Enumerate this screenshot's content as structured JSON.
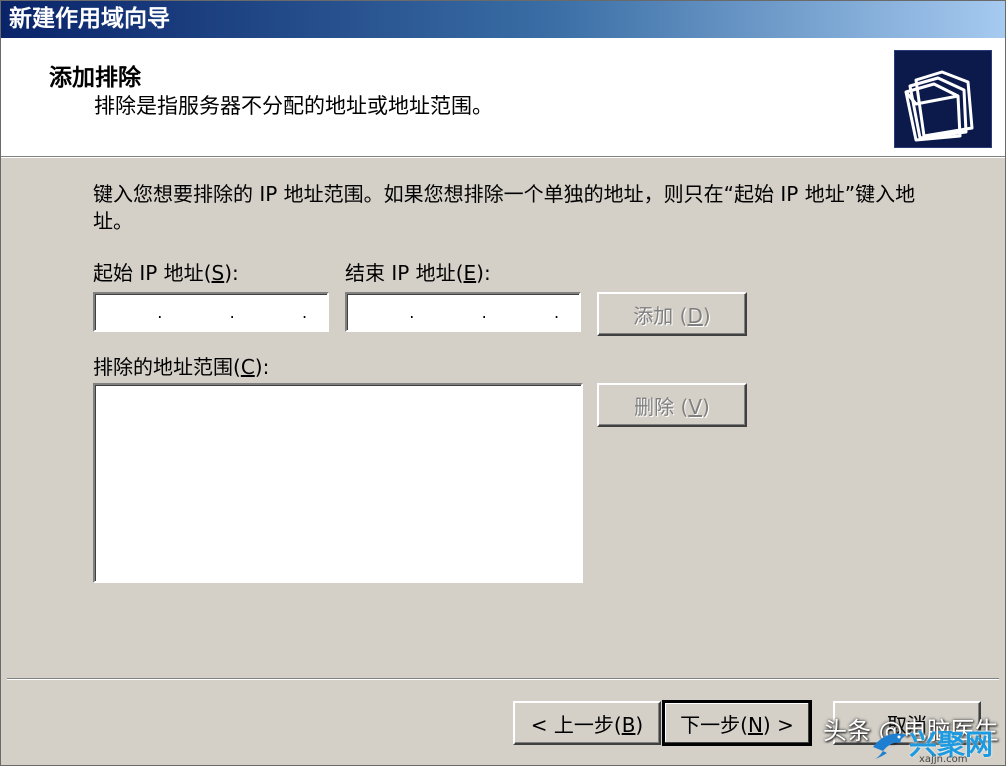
{
  "window": {
    "title": "新建作用域向导"
  },
  "header": {
    "title": "添加排除",
    "subtitle": "排除是指服务器不分配的地址或地址范围。",
    "icon": "folders-icon"
  },
  "body": {
    "instruction": "键入您想要排除的 IP 地址范围。如果您想排除一个单独的地址，则只在“起始 IP 地址”键入地址。"
  },
  "start_ip": {
    "label": "起始 IP 地址",
    "mnemonic": "S",
    "suffix": "):",
    "value": "   .   .   ."
  },
  "end_ip": {
    "label": "结束 IP 地址",
    "mnemonic": "E",
    "suffix": "):",
    "value": "   .   .   ."
  },
  "add_button": {
    "label": "添加",
    "mnemonic": "D"
  },
  "excluded_list": {
    "label": "排除的地址范围",
    "mnemonic": "C",
    "suffix": "):",
    "items": []
  },
  "remove_button": {
    "label": "删除",
    "mnemonic": "V"
  },
  "footer": {
    "back": {
      "label": "< 上一步",
      "mnemonic": "B"
    },
    "next": {
      "label": "下一步",
      "mnemonic": "N",
      "suffix": ") >"
    },
    "cancel": {
      "label": "取消"
    }
  },
  "watermark": {
    "text": "头条 @电脑医生",
    "site": "兴聚网",
    "url": "xajjn.com"
  },
  "colors": {
    "title_start": "#0a246a",
    "title_end": "#a6caf0",
    "face": "#d4d0c8",
    "disabled_text": "#808080"
  }
}
